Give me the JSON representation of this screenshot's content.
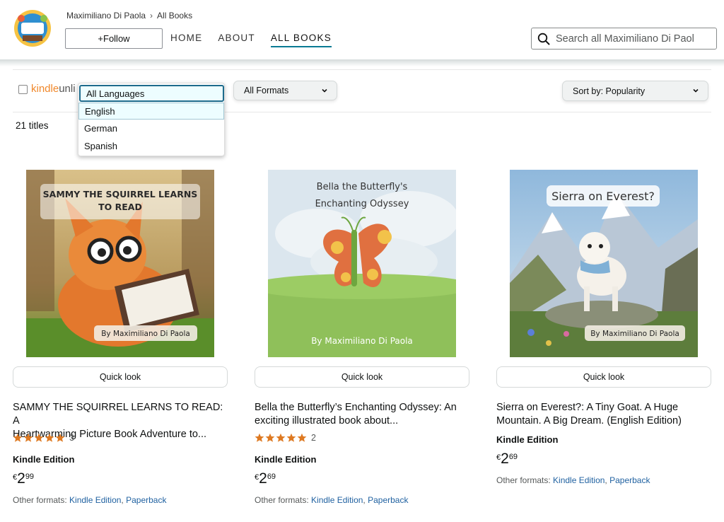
{
  "header": {
    "breadcrumb": [
      "Maximiliano Di Paola",
      "All Books"
    ],
    "follow_label": "+Follow",
    "nav": [
      {
        "label": "HOME",
        "active": false
      },
      {
        "label": "ABOUT",
        "active": false
      },
      {
        "label": "ALL BOOKS",
        "active": true
      }
    ],
    "search_placeholder": "Search all Maximiliano Di Paol"
  },
  "filters": {
    "kindle_unlimited_label": "kindleunli",
    "formats_label": "All Formats",
    "sort_label": "Sort by: Popularity",
    "titles_count": "21 titles",
    "language_options": [
      "All Languages",
      "English",
      "German",
      "Spanish"
    ]
  },
  "products": [
    {
      "cover_title": "SAMMY THE SQUIRREL LEARNS TO READ",
      "cover_author": "By Maximiliano Di Paola",
      "quick_look": "Quick look",
      "title_line1": "SAMMY THE SQUIRREL LEARNS TO READ: A",
      "title_line2": "Heartwarming Picture Book Adventure to...",
      "stars": 5,
      "rating_count": "3",
      "edition": "Kindle Edition",
      "price_symbol": "€",
      "price_whole": "2",
      "price_fraction": "99",
      "other_formats_label": "Other formats:",
      "formats": [
        "Kindle Edition",
        "Paperback"
      ]
    },
    {
      "cover_title_line1": "Bella the Butterfly's",
      "cover_title_line2": "Enchanting Odyssey",
      "cover_author": "By Maximiliano Di Paola",
      "quick_look": "Quick look",
      "title_line1": "Bella the Butterfly’s Enchanting Odyssey: An",
      "title_line2": "exciting illustrated book about...",
      "stars": 5,
      "rating_count": "2",
      "edition": "Kindle Edition",
      "price_symbol": "€",
      "price_whole": "2",
      "price_fraction": "69",
      "other_formats_label": "Other formats:",
      "formats": [
        "Kindle Edition",
        "Paperback"
      ]
    },
    {
      "cover_title": "Sierra on Everest?",
      "cover_author": "By Maximiliano Di Paola",
      "quick_look": "Quick look",
      "title_line1": "Sierra on Everest?: A Tiny Goat. A Huge",
      "title_line2": "Mountain. A Big Dream. (English Edition)",
      "edition": "Kindle Edition",
      "price_symbol": "€",
      "price_whole": "2",
      "price_fraction": "69",
      "other_formats_label": "Other formats:",
      "formats": [
        "Kindle Edition",
        "Paperback"
      ]
    }
  ],
  "colors": {
    "link": "#2162a1",
    "star": "#de7921",
    "nav_underline": "#0a7a94"
  }
}
